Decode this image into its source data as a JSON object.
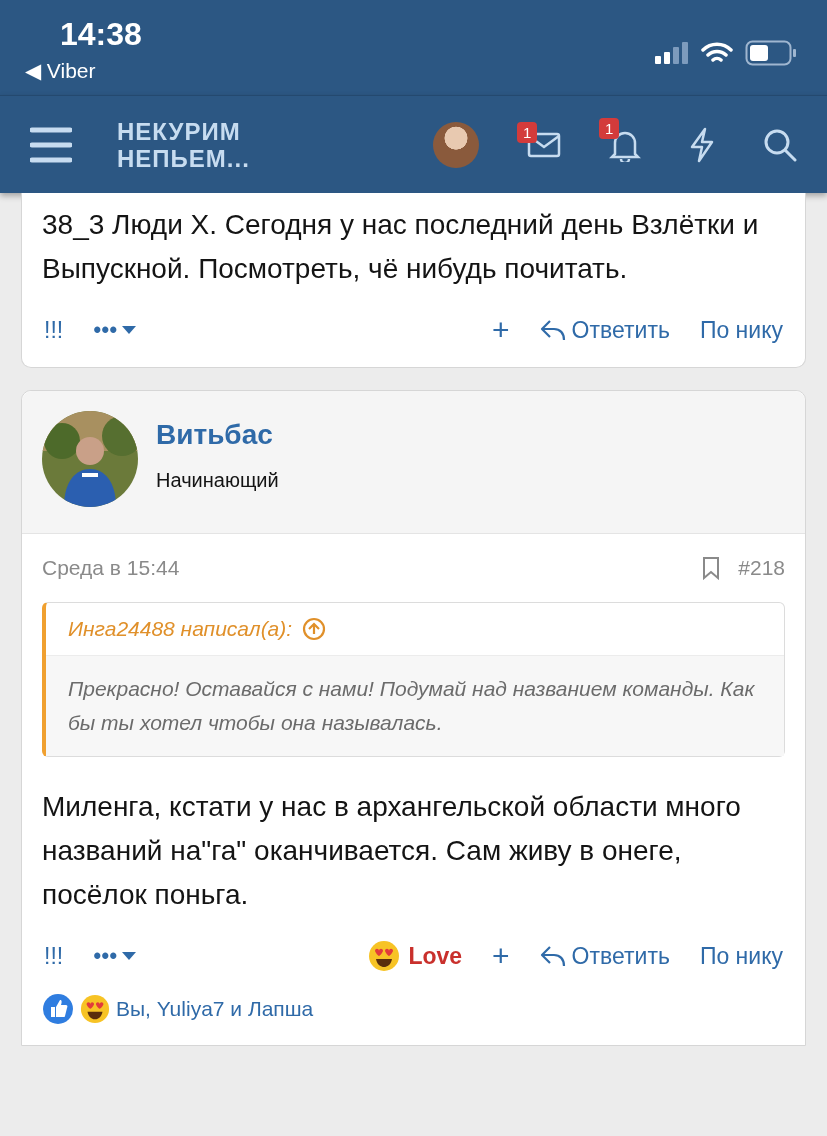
{
  "status_bar": {
    "time": "14:38",
    "back_app": "◀ Viber"
  },
  "header": {
    "logo_lines": [
      "НЕКУРИМ",
      "НЕПЬЕМ..."
    ],
    "messages_badge": "1",
    "alerts_badge": "1"
  },
  "prev_post": {
    "text": "38_3 Люди Х. Сегодня у нас последний день Взлётки и Выпускной. Посмотреть, чё нибудь почитать.",
    "actions": {
      "flag": "!!!",
      "more": "•••",
      "plus": "+",
      "reply": "Ответить",
      "by_nick": "По нику"
    }
  },
  "post": {
    "author": "Витьбас",
    "rank": "Начинающий",
    "date": "Среда в 15:44",
    "number": "#218",
    "bookmarked": false,
    "quote": {
      "author": "Инга24488 написал(а):",
      "text": "Прекрасно! Оставайся с нами! Подумай над названием команды. Как бы ты хотел чтобы она называлась."
    },
    "text": "Миленга, кстати у нас в архангельской области много названий на\"га\" оканчивается. Сам живу в онеге, посёлок поньга.",
    "actions": {
      "flag": "!!!",
      "more": "•••",
      "reaction": "Love",
      "plus": "+",
      "reply": "Ответить",
      "by_nick": "По нику"
    },
    "reacted_by": "Вы, Yuliya7 и Лапша"
  }
}
